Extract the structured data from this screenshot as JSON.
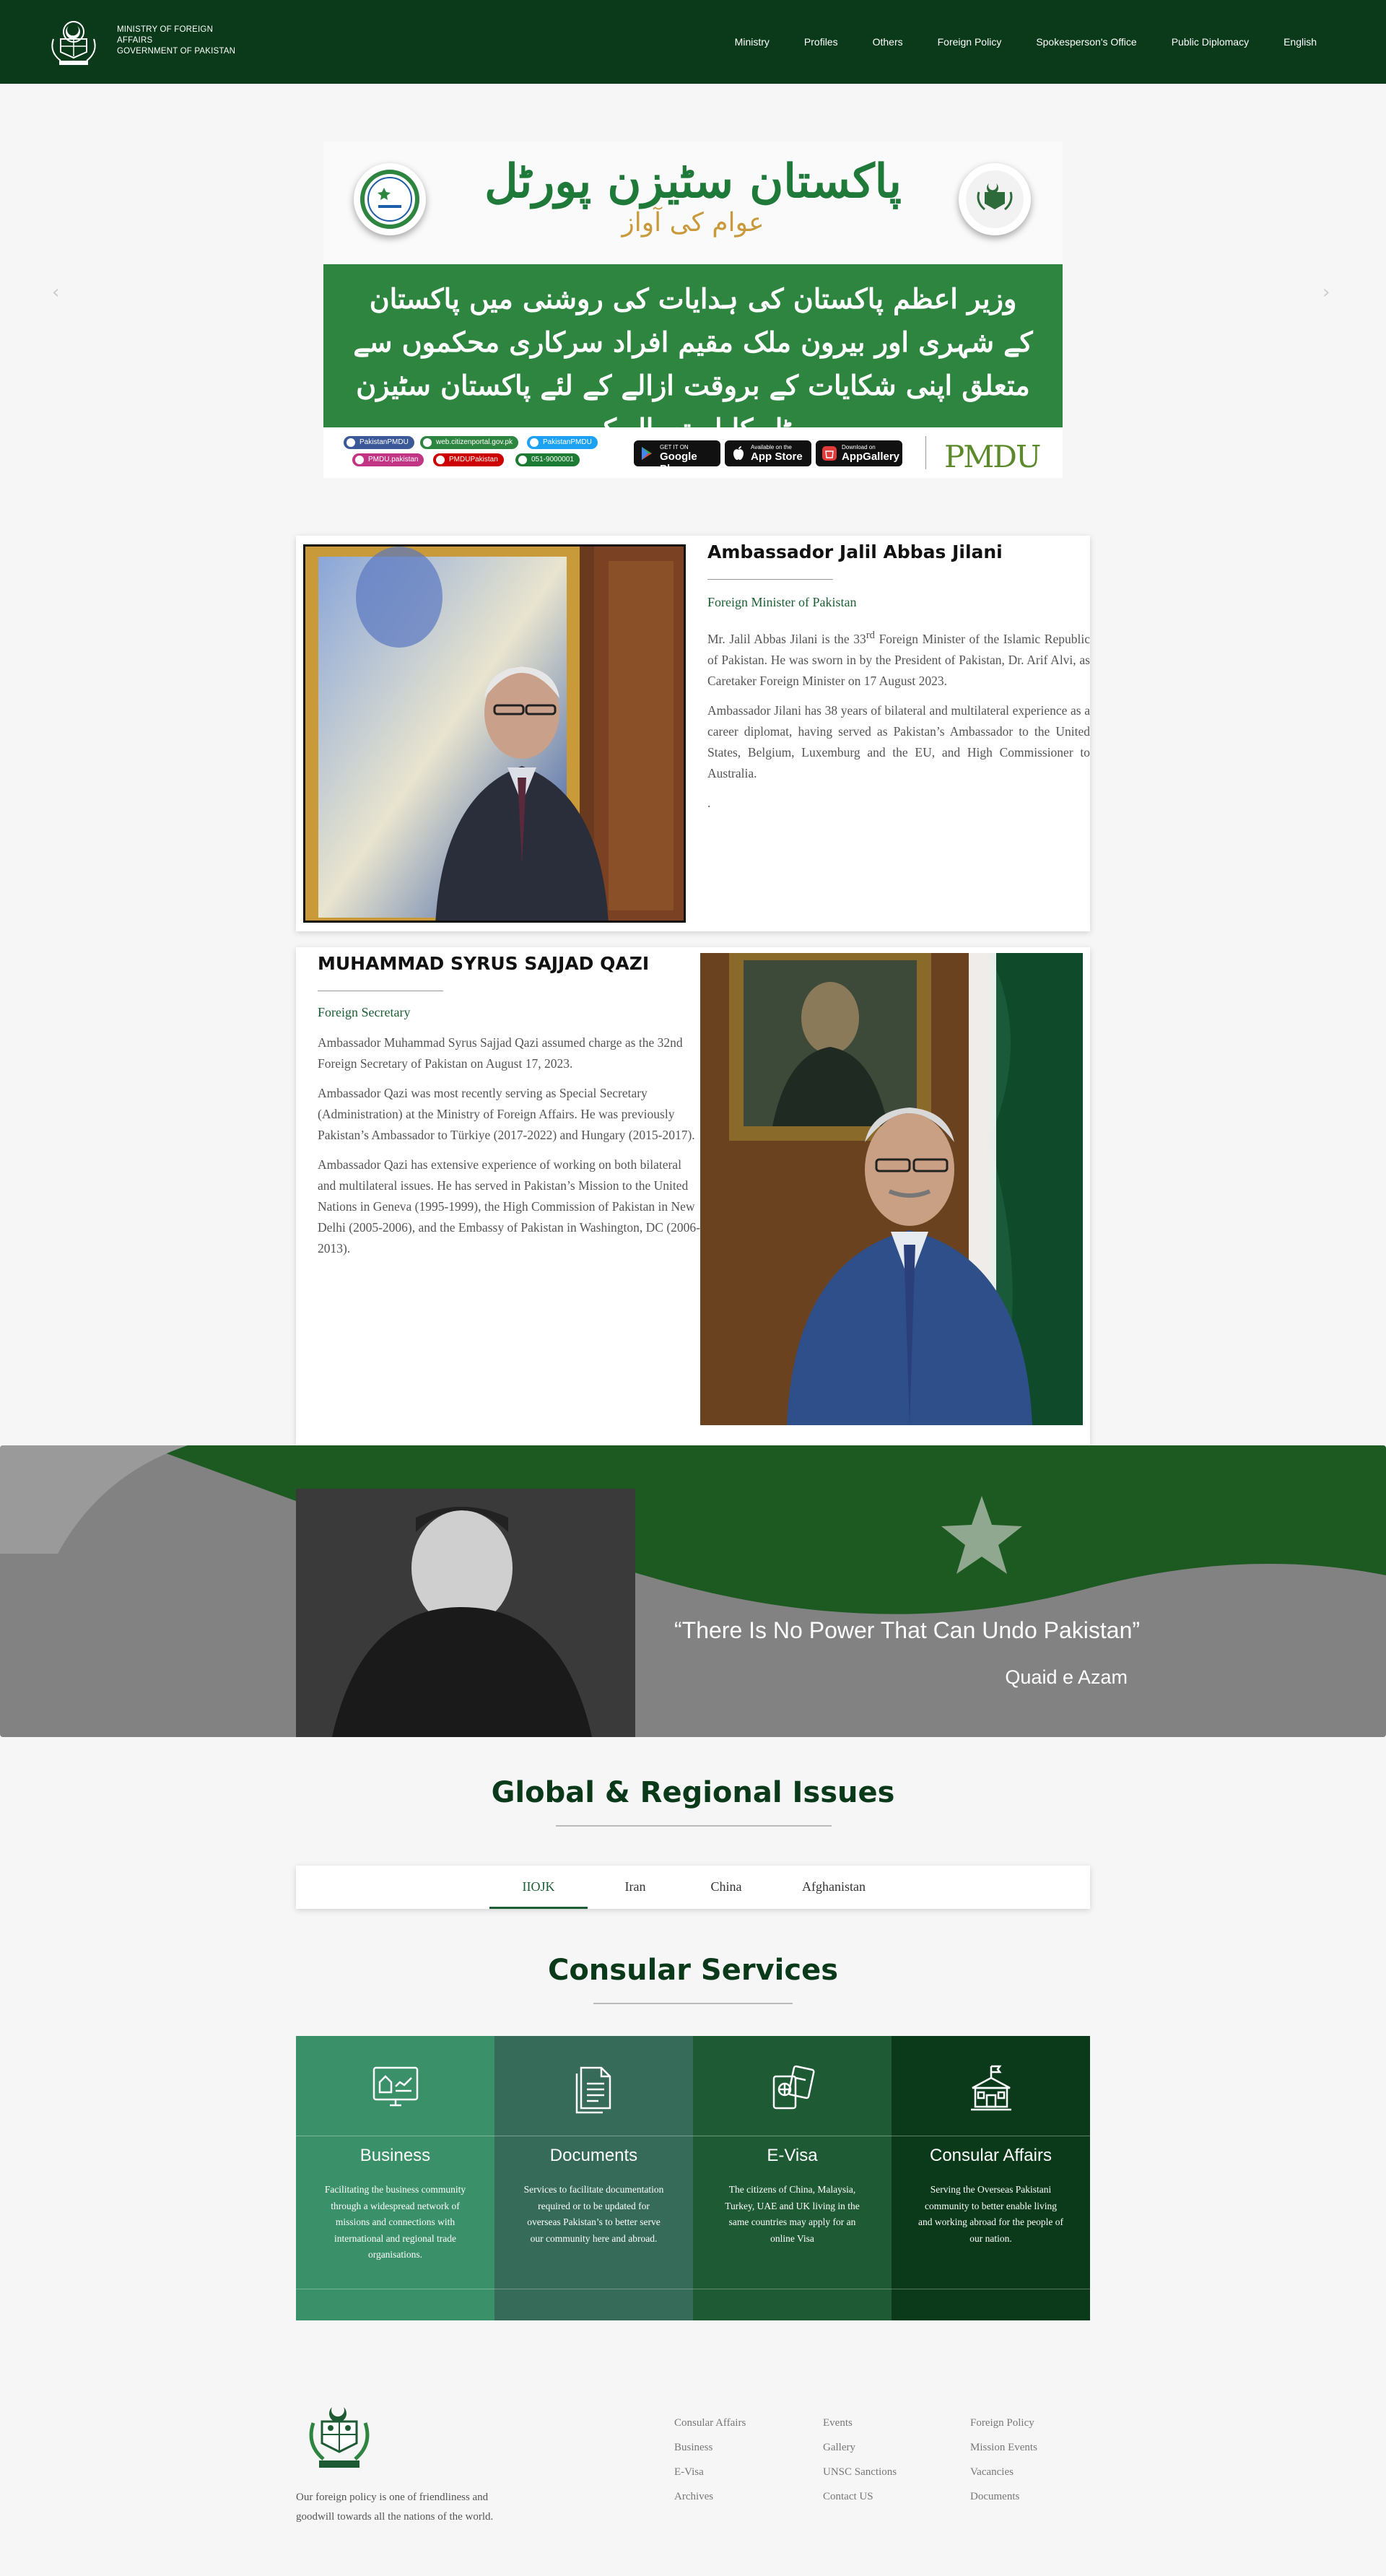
{
  "header": {
    "logo_line1": "MINISTRY OF FOREIGN",
    "logo_line2": "AFFAIRS",
    "logo_line3": "GOVERNMENT OF PAKISTAN",
    "nav": [
      "Ministry",
      "Profiles",
      "Others",
      "Foreign Policy",
      "Spokesperson's Office",
      "Public Diplomacy",
      "English"
    ]
  },
  "banner": {
    "title_urdu": "پاکستان سٹیزن پورٹل",
    "subtitle_urdu": "عوام کی آواز",
    "body_urdu": "وزیر اعظم پاکستان کی ہدایات کی روشنی میں پاکستان کے شہری اور بیرون ملک مقیم افراد سرکاری محکموں سے متعلق اپنی شکایات کے بروقت ازالے کے لئے پاکستان سٹیزن پورٹل کا استعمال کریں",
    "social": [
      "PakistanPMDU",
      "web.citizenportal.gov.pk",
      "PakistanPMDU",
      "PMDU.pakistan",
      "PMDUPakistan",
      "051-9000001"
    ],
    "stores": [
      {
        "small": "GET IT ON",
        "big": "Google Play"
      },
      {
        "small": "Available on the",
        "big": "App Store"
      },
      {
        "small": "Download on",
        "big": "AppGallery"
      }
    ],
    "pmdu_logo": "PMDU",
    "prev_icon": "‹",
    "next_icon": "›",
    "accent": "#2e8540"
  },
  "profile1": {
    "name": "Ambassador Jalil Abbas Jilani",
    "role": "Foreign Minister of Pakistan",
    "p1_a": "Mr. Jalil Abbas Jilani is the 33",
    "p1_sup": "rd",
    "p1_b": " Foreign Minister of the Islamic Republic of Pakistan. He was sworn in by the President of Pakistan, Dr. Arif Alvi, as Caretaker Foreign Minister on 17 August 2023.",
    "p2": "Ambassador Jilani has 38 years of bilateral and multilateral experience as a career diplomat, having served as Pakistan’s Ambassador to the United States, Belgium, Luxemburg and the EU, and High Commissioner to Australia.",
    "p3": "."
  },
  "profile2": {
    "name": "MUHAMMAD SYRUS SAJJAD QAZI",
    "role": "Foreign Secretary",
    "p1": "Ambassador Muhammad Syrus Sajjad Qazi assumed charge as the 32nd Foreign Secretary of Pakistan on August 17, 2023.",
    "p2": "Ambassador Qazi was most recently serving as Special Secretary (Administration) at the Ministry of Foreign Affairs. He was previously Pakistan’s Ambassador to Türkiye (2017-2022) and Hungary (2015-2017).",
    "p3": "Ambassador Qazi has extensive experience of working on both bilateral and multilateral issues.  He has served in Pakistan’s Mission to the United Nations in Geneva (1995-1999), the High Commission of Pakistan in New Delhi (2005-2006), and the Embassy of Pakistan in Washington, DC (2006-2013)."
  },
  "quote": {
    "text": "“There Is No Power That Can Undo Pakistan”",
    "author": "Quaid e Azam"
  },
  "issues": {
    "title": "Global & Regional Issues",
    "tabs": [
      "IIOJK",
      "Iran",
      "China",
      "Afghanistan"
    ],
    "active_tab": "IIOJK"
  },
  "consular": {
    "title": "Consular Services",
    "cards": [
      {
        "title": "Business",
        "desc": "Facilitating the business community through a widespread network of missions and connections with international and regional trade organisations.",
        "icon": "business-icon",
        "color": "#3a9068"
      },
      {
        "title": "Documents",
        "desc": "Services to facilitate documentation required or to be updated for overseas Pakistan’s to better serve our community here and abroad.",
        "icon": "documents-icon",
        "color": "#356b58"
      },
      {
        "title": "E-Visa",
        "desc": "The citizens of China, Malaysia, Turkey, UAE and UK living in the same countries may apply for an online Visa",
        "icon": "passport-icon",
        "color": "#1e5a34"
      },
      {
        "title": "Consular Affairs",
        "desc": "Serving the Overseas Pakistani community to better enable living and working abroad for the people of our nation.",
        "icon": "building-icon",
        "color": "#0b3a1b"
      }
    ]
  },
  "footer": {
    "tagline_1": "Our foreign policy is one of friendliness and",
    "tagline_2": "goodwill towards all the nations of the world.",
    "col1": [
      "Consular Affairs",
      "Business",
      "E-Visa",
      "Archives"
    ],
    "col2": [
      "Events",
      "Gallery",
      "UNSC Sanctions",
      "Contact US"
    ],
    "col3": [
      "Foreign Policy",
      "Mission Events",
      "Vacancies",
      "Documents"
    ]
  }
}
